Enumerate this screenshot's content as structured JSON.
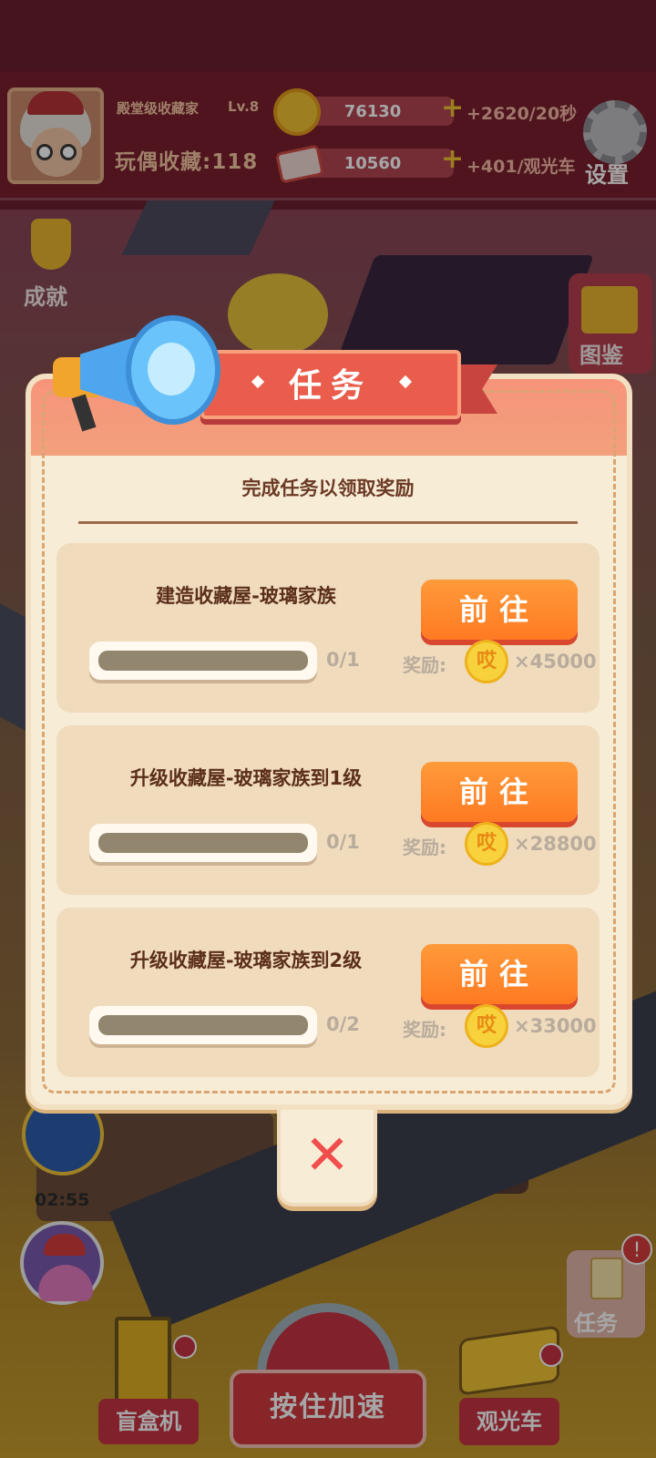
{
  "hud": {
    "title": "殿堂级收藏家",
    "level": "Lv.8",
    "collection": "玩偶收藏:118",
    "coins": "76130",
    "coin_rate": "+2620/20秒",
    "tickets": "10560",
    "ticket_rate": "+401/观光车",
    "settings_label": "设置"
  },
  "side": {
    "achievement_label": "成就",
    "atlas_label": "图鉴",
    "timer": "02:55",
    "task_label": "任务",
    "task_alert": "!"
  },
  "bottom": {
    "blind_box_label": "盲盒机",
    "hold_label": "按住加速",
    "tour_bus_label": "观光车"
  },
  "modal": {
    "title": "任务",
    "subtitle": "完成任务以领取奖励",
    "reward_label": "奖励:",
    "go_label": "前往",
    "coin_glyph": "哎",
    "close_glyph": "✕",
    "tasks": [
      {
        "name": "建造收藏屋-玻璃家族",
        "progress_text": "0/1",
        "progress": 0,
        "reward": "×45000"
      },
      {
        "name": "升级收藏屋-玻璃家族到1级",
        "progress_text": "0/1",
        "progress": 0,
        "reward": "×28800"
      },
      {
        "name": "升级收藏屋-玻璃家族到2级",
        "progress_text": "0/2",
        "progress": 0,
        "reward": "×33000"
      }
    ]
  },
  "colors": {
    "accent": "#ff7a22",
    "header": "#7a1f2d",
    "modal_bg": "#f7ecd6"
  }
}
